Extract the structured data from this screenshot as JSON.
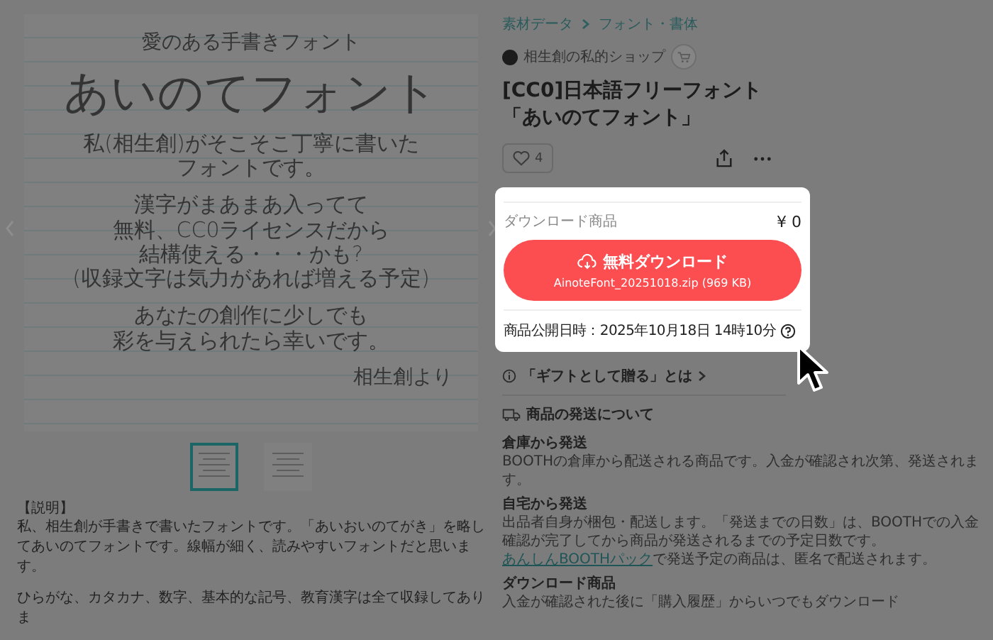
{
  "product_image": {
    "blocks": [
      {
        "kind": "subtitle",
        "lines": [
          "愛のある手書きフォント"
        ]
      },
      {
        "kind": "headline",
        "lines": [
          "あいのてフォント"
        ]
      },
      {
        "kind": "paragraph",
        "lines": [
          "私(相生創)がそこそこ丁寧に書いた",
          "フォントです。"
        ]
      },
      {
        "kind": "paragraph",
        "lines": [
          "漢字がまあまあ入ってて",
          "無料、CC0ライセンスだから",
          "結構使える・・・かも?",
          "(収録文字は気力があれば増える予定)"
        ]
      },
      {
        "kind": "paragraph",
        "lines": [
          "あなたの創作に少しでも",
          "彩を与えられたら幸いです。"
        ]
      },
      {
        "kind": "signature",
        "lines": [
          "相生創より"
        ]
      }
    ]
  },
  "thumbnails": [
    {
      "selected": true
    },
    {
      "selected": false
    }
  ],
  "description": {
    "heading": "【説明】",
    "paragraphs": [
      "私、相生創が手書きで書いたフォントです。「あいおいのてがき」を略してあいのてフォントです。線幅が細く、読みやすいフォントだと思います。",
      "ひらがな、カタカナ、数字、基本的な記号、教育漢字は全て収録してありま"
    ]
  },
  "breadcrumb": [
    "素材データ",
    "フォント・書体"
  ],
  "shop": {
    "name": "相生創の私的ショップ"
  },
  "title_lines": [
    "[CC0]日本語フリーフォント",
    "「あいのてフォント」"
  ],
  "likes": {
    "count": "4"
  },
  "download_card": {
    "label": "ダウンロード商品",
    "price": "¥ 0",
    "button": {
      "label": "無料ダウンロード",
      "file": "AinoteFont_20251018.zip (969 KB)"
    },
    "published": "商品公開日時：2025年10月18日 14時10分"
  },
  "gift_link": "「ギフトとして贈る」とは",
  "shipping": {
    "heading": "商品の発送について",
    "sections": [
      {
        "title": "倉庫から発送",
        "texts": [
          {
            "text": "BOOTHの倉庫から配送される商品です。入金が確認され次第、発送されます。"
          }
        ]
      },
      {
        "title": "自宅から発送",
        "texts": [
          {
            "text": "出品者自身が梱包・配送します。「発送までの日数」は、BOOTHでの入金確認が完了してから商品が発送されるまでの予定日数です。"
          },
          {
            "link": "あんしんBOOTHパック",
            "text": "で発送予定の商品は、匿名で配送されます。"
          }
        ]
      },
      {
        "title": "ダウンロード商品",
        "texts": [
          {
            "text": "入金が確認された後に「購入履歴」からいつでもダウンロード"
          }
        ]
      }
    ]
  }
}
